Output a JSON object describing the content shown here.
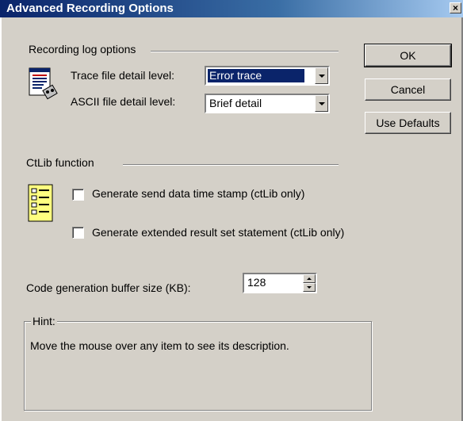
{
  "window": {
    "title": "Advanced Recording Options",
    "close_glyph": "×"
  },
  "recording_log": {
    "section_label": "Recording log options",
    "icon": "document-log-icon",
    "trace_label": "Trace file detail level:",
    "trace_value": "Error trace",
    "ascii_label": "ASCII file detail level:",
    "ascii_value": "Brief detail"
  },
  "ctlib": {
    "section_label": "CtLib function",
    "icon": "checklist-icon",
    "option1": {
      "label": "Generate send data time stamp (ctLib only)",
      "checked": false
    },
    "option2": {
      "label": "Generate extended result set statement (ctLib only)",
      "checked": false
    }
  },
  "buffer": {
    "label": "Code generation buffer size (KB):",
    "value": "128"
  },
  "hint": {
    "legend": "Hint:",
    "text": "Move the mouse over any item to see its description."
  },
  "buttons": {
    "ok": "OK",
    "cancel": "Cancel",
    "defaults": "Use Defaults"
  },
  "colors": {
    "title_start": "#0a246a",
    "title_end": "#a6caf0",
    "face": "#d4d0c8",
    "selection": "#0a246a"
  }
}
